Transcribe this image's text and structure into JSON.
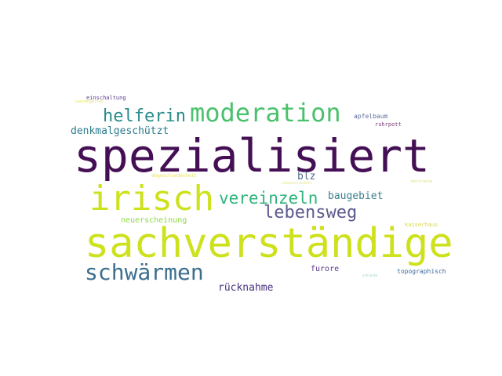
{
  "words": [
    {
      "text": "spezialisiert",
      "color": "#440f54"
    },
    {
      "text": "sachverständige",
      "color": "#cde11d"
    },
    {
      "text": "irisch",
      "color": "#cde11d"
    },
    {
      "text": "moderation",
      "color": "#4ac16d"
    },
    {
      "text": "schwärmen",
      "color": "#3b6f8e"
    },
    {
      "text": "lebensweg",
      "color": "#5b5a8e"
    },
    {
      "text": "vereinzeln",
      "color": "#2fb47c"
    },
    {
      "text": "helferin",
      "color": "#2b8c8c"
    },
    {
      "text": "denkmalgeschützt",
      "color": "#2b7c8e"
    },
    {
      "text": "baugebiet",
      "color": "#3b7f8e"
    },
    {
      "text": "blz",
      "color": "#4d6a8a"
    },
    {
      "text": "rücknahme",
      "color": "#46327e"
    },
    {
      "text": "neuerscheinung",
      "color": "#8fd744"
    },
    {
      "text": "furore",
      "color": "#5c3b8a"
    },
    {
      "text": "topographisch",
      "color": "#3a6a9a"
    },
    {
      "text": "apfelbaum",
      "color": "#5e6f9a"
    },
    {
      "text": "ruhrpott",
      "color": "#7b3a80"
    },
    {
      "text": "einschaltung",
      "color": "#5c3b8a"
    },
    {
      "text": "kaiserhaus",
      "color": "#d9d84a"
    },
    {
      "text": "abgeschiedenheit",
      "color": "#e8e35a"
    },
    {
      "text": "sonnengarten",
      "color": "#e8e35a"
    },
    {
      "text": "heitrache",
      "color": "#e0e070"
    },
    {
      "text": "schwesternschaft",
      "color": "#e0e070"
    },
    {
      "text": "schlecke",
      "color": "#9ad0b0"
    }
  ]
}
